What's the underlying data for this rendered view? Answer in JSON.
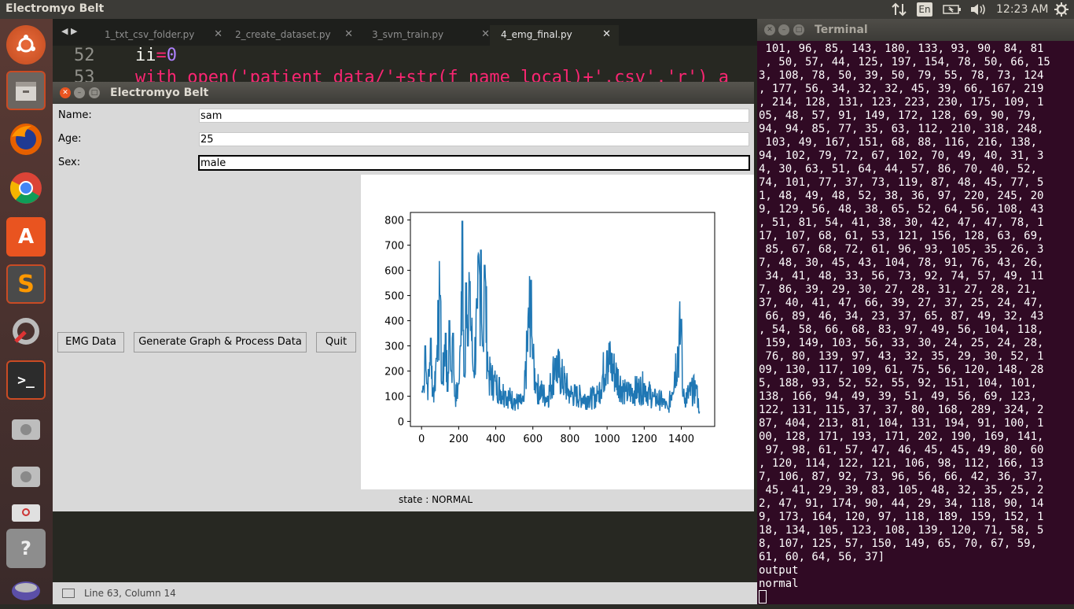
{
  "top_panel": {
    "title": "Electromyo Belt",
    "lang": "En",
    "clock": "12:23 AM"
  },
  "launcher": {
    "items": [
      "ubuntu-dash",
      "files",
      "firefox",
      "chrome",
      "software-center",
      "sublime-text",
      "system-settings",
      "terminal",
      "drive-1",
      "drive-2",
      "drive-3",
      "help",
      "trash"
    ]
  },
  "editor": {
    "tabs": [
      {
        "label": "1_txt_csv_folder.py"
      },
      {
        "label": "2_create_dataset.py"
      },
      {
        "label": "3_svm_train.py"
      },
      {
        "label": "4_emg_final.py"
      }
    ],
    "lines": [
      {
        "num": "52",
        "code": "ii=0"
      },
      {
        "num": "53",
        "code": "with open('patient_data/'+str(f_name_local)+'.csv','r') a"
      }
    ],
    "status": "Line 63, Column 14"
  },
  "tk_window": {
    "title": "Electromyo Belt",
    "form": {
      "name_label": "Name:",
      "name_value": "sam",
      "age_label": "Age:",
      "age_value": "25",
      "sex_label": "Sex:",
      "sex_value": "male"
    },
    "buttons": {
      "emg": "EMG Data",
      "generate": "Generate Graph & Process Data",
      "quit": "Quit"
    },
    "state": "state : NORMAL"
  },
  "chart_data": {
    "type": "line",
    "color": "#1f77b4",
    "xlim": [
      -60,
      1580
    ],
    "ylim": [
      -20,
      830
    ],
    "xticks": [
      0,
      200,
      400,
      600,
      800,
      1000,
      1200,
      1400
    ],
    "yticks": [
      0,
      100,
      200,
      300,
      400,
      500,
      600,
      700,
      800
    ],
    "num_points": 1500,
    "key_points": [
      [
        0,
        120
      ],
      [
        10,
        140
      ],
      [
        20,
        300
      ],
      [
        30,
        150
      ],
      [
        40,
        180
      ],
      [
        50,
        330
      ],
      [
        60,
        100
      ],
      [
        80,
        250
      ],
      [
        90,
        480
      ],
      [
        100,
        500
      ],
      [
        110,
        150
      ],
      [
        130,
        350
      ],
      [
        140,
        120
      ],
      [
        150,
        400
      ],
      [
        160,
        200
      ],
      [
        170,
        350
      ],
      [
        180,
        100
      ],
      [
        200,
        150
      ],
      [
        210,
        300
      ],
      [
        220,
        795
      ],
      [
        230,
        180
      ],
      [
        240,
        550
      ],
      [
        250,
        300
      ],
      [
        260,
        555
      ],
      [
        280,
        200
      ],
      [
        300,
        450
      ],
      [
        320,
        680
      ],
      [
        330,
        300
      ],
      [
        340,
        620
      ],
      [
        360,
        200
      ],
      [
        400,
        160
      ],
      [
        450,
        120
      ],
      [
        500,
        90
      ],
      [
        550,
        80
      ],
      [
        590,
        560
      ],
      [
        600,
        250
      ],
      [
        620,
        150
      ],
      [
        680,
        100
      ],
      [
        720,
        250
      ],
      [
        800,
        120
      ],
      [
        900,
        100
      ],
      [
        950,
        110
      ],
      [
        1000,
        280
      ],
      [
        1100,
        120
      ],
      [
        1200,
        150
      ],
      [
        1250,
        100
      ],
      [
        1300,
        90
      ],
      [
        1330,
        50
      ],
      [
        1400,
        405
      ],
      [
        1410,
        100
      ],
      [
        1480,
        145
      ],
      [
        1499,
        40
      ]
    ]
  },
  "terminal": {
    "title": "Terminal",
    "lines": [
      " 101, 96, 85, 143, 180, 133, 93, 90, 84, 81",
      " , 50, 57, 44, 125, 197, 154, 78, 50, 66, 15",
      "3, 108, 78, 50, 39, 50, 79, 55, 78, 73, 124",
      ", 177, 56, 34, 32, 32, 45, 39, 66, 167, 219",
      ", 214, 128, 131, 123, 223, 230, 175, 109, 1",
      "05, 48, 57, 91, 149, 172, 128, 69, 90, 79,",
      "94, 94, 85, 77, 35, 63, 112, 210, 318, 248,",
      " 103, 49, 167, 151, 68, 88, 116, 216, 138,",
      "94, 102, 79, 72, 67, 102, 70, 49, 40, 31, 3",
      "4, 30, 63, 51, 64, 44, 57, 86, 70, 40, 52,",
      "74, 101, 77, 37, 73, 119, 87, 48, 45, 77, 5",
      "1, 48, 49, 48, 52, 38, 36, 97, 220, 245, 20",
      "9, 129, 56, 48, 38, 65, 52, 64, 56, 108, 43",
      ", 51, 81, 54, 41, 38, 30, 42, 47, 47, 78, 1",
      "17, 107, 68, 61, 53, 121, 156, 128, 63, 69,",
      " 85, 67, 68, 72, 61, 96, 93, 105, 35, 26, 3",
      "7, 48, 30, 45, 43, 104, 78, 91, 76, 43, 26,",
      " 34, 41, 48, 33, 56, 73, 92, 74, 57, 49, 11",
      "7, 86, 39, 29, 30, 27, 28, 31, 27, 28, 21,",
      "37, 40, 41, 47, 66, 39, 27, 37, 25, 24, 47,",
      " 66, 89, 46, 34, 23, 37, 65, 87, 49, 32, 43",
      ", 54, 58, 66, 68, 83, 97, 49, 56, 104, 118,",
      " 159, 149, 103, 56, 33, 30, 24, 25, 24, 28,",
      " 76, 80, 139, 97, 43, 32, 35, 29, 30, 52, 1",
      "09, 130, 117, 109, 61, 75, 56, 120, 148, 28",
      "5, 188, 93, 52, 52, 55, 92, 151, 104, 101,",
      "138, 166, 94, 49, 39, 51, 49, 56, 69, 123,",
      "122, 131, 115, 37, 37, 80, 168, 289, 324, 2",
      "87, 404, 213, 81, 104, 131, 194, 91, 100, 1",
      "00, 128, 171, 193, 171, 202, 190, 169, 141,",
      " 97, 98, 61, 57, 47, 46, 45, 45, 49, 80, 60",
      ", 120, 114, 122, 121, 106, 98, 112, 166, 13",
      "7, 106, 87, 92, 73, 96, 56, 66, 42, 36, 37,",
      " 45, 41, 29, 39, 83, 105, 48, 32, 35, 25, 2",
      "2, 47, 91, 174, 90, 44, 29, 34, 118, 90, 14",
      "9, 173, 164, 120, 97, 118, 189, 159, 152, 1",
      "18, 134, 105, 123, 108, 139, 120, 71, 58, 5",
      "8, 107, 125, 57, 150, 149, 65, 70, 67, 59,",
      "61, 60, 64, 56, 37]",
      "output",
      "normal"
    ]
  }
}
